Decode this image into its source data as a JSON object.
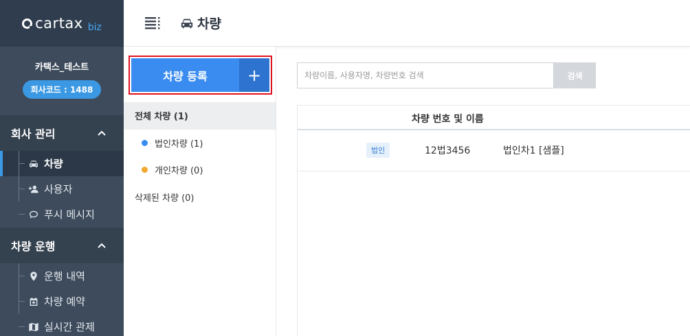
{
  "brand": {
    "logo_text": "cartax",
    "logo_sub": "biz"
  },
  "company": {
    "name": "카택스_테스트",
    "code": "회사코드 : 1488"
  },
  "sidebar": {
    "sections": [
      {
        "title": "회사 관리",
        "chevron": "^",
        "items": [
          {
            "label": "차량",
            "icon": "car-icon",
            "active": true
          },
          {
            "label": "사용자",
            "icon": "user-plus-icon",
            "active": false
          },
          {
            "label": "푸시 메시지",
            "icon": "chat-bubble-icon",
            "active": false
          }
        ]
      },
      {
        "title": "차량 운행",
        "chevron": "^",
        "items": [
          {
            "label": "운행 내역",
            "icon": "map-pin-icon",
            "active": false
          },
          {
            "label": "차량 예약",
            "icon": "calendar-plus-icon",
            "active": false
          },
          {
            "label": "실시간 관제",
            "icon": "map-icon",
            "active": false
          }
        ]
      }
    ]
  },
  "header": {
    "title": "차량",
    "menu_icon": "list-menu-icon",
    "page_icon": "car-icon"
  },
  "register": {
    "label": "차량 등록",
    "plus": "+"
  },
  "categories": {
    "all": "전체 차량 (1)",
    "corporate": "법인차량 (1)",
    "personal": "개인차량 (0)",
    "deleted": "삭제된 차량 (0)",
    "colors": {
      "corporate": "#3a8cf0",
      "personal": "#f0a830"
    }
  },
  "search": {
    "placeholder": "차량이름, 사용자명, 차량번호 검색",
    "button": "검색",
    "value": ""
  },
  "table": {
    "header": "차량 번호 및 이름",
    "rows": [
      {
        "badge": "법인",
        "number": "12법3456",
        "name": "법인차1 [샘플]"
      }
    ]
  },
  "colors": {
    "accent": "#3a8cf0",
    "sidebar_bg": "#3d4b5c",
    "highlight_border": "#e0101f"
  }
}
